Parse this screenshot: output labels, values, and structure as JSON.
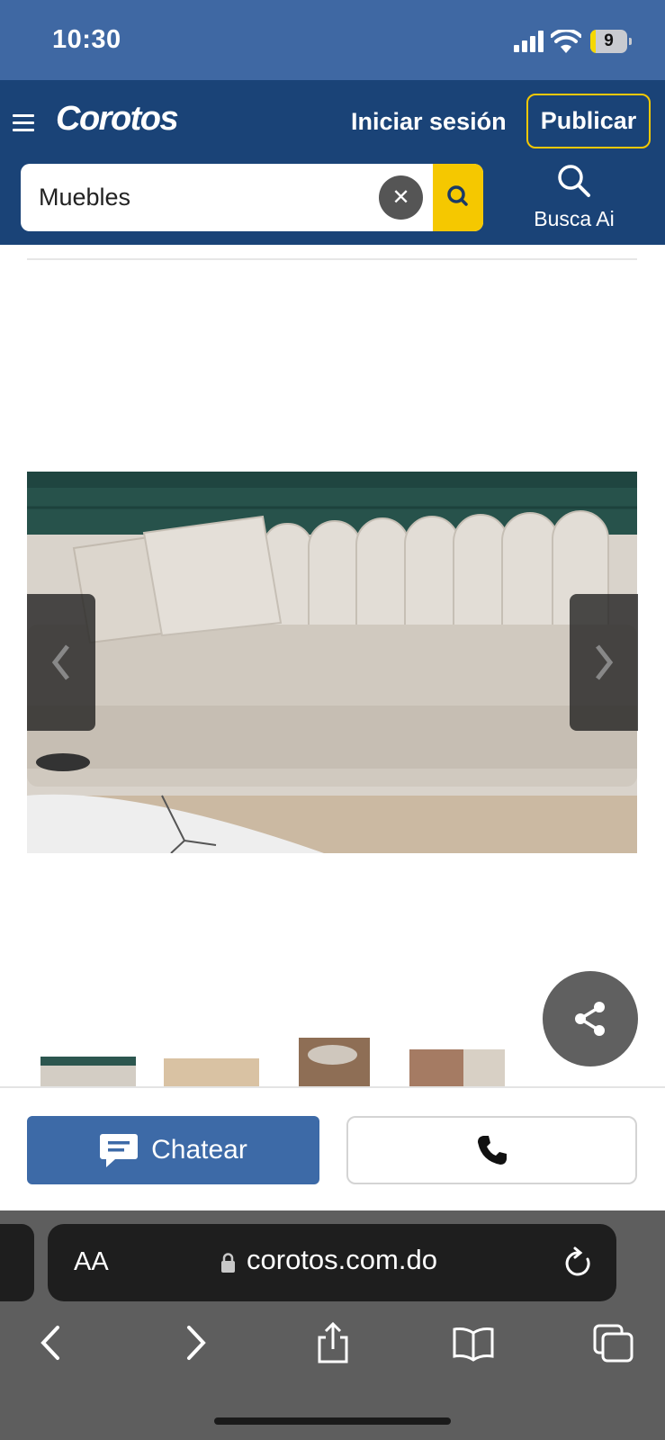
{
  "status_bar": {
    "time": "10:30",
    "battery": "9"
  },
  "header": {
    "logo": "Corotos",
    "login_label": "Iniciar sesión",
    "publish_label": "Publicar",
    "search": {
      "value": "Muebles",
      "placeholder": ""
    },
    "busca_ai_label": "Busca Ai"
  },
  "actions": {
    "chat_label": "Chatear"
  },
  "browser": {
    "text_size_label": "AA",
    "url": "corotos.com.do"
  },
  "colors": {
    "status_bar": "#3f68a3",
    "header": "#1a4377",
    "accent_yellow": "#f5c800",
    "chat_button": "#3d6aa7"
  },
  "icons": [
    "menu-icon",
    "clear-icon",
    "search-icon",
    "busca-ai-icon",
    "chevron-left-icon",
    "chevron-right-icon",
    "share-icon",
    "chat-bubble-icon",
    "phone-icon",
    "lock-icon",
    "reload-icon",
    "back-icon",
    "forward-icon",
    "share-sheet-icon",
    "bookmarks-icon",
    "tabs-icon"
  ]
}
